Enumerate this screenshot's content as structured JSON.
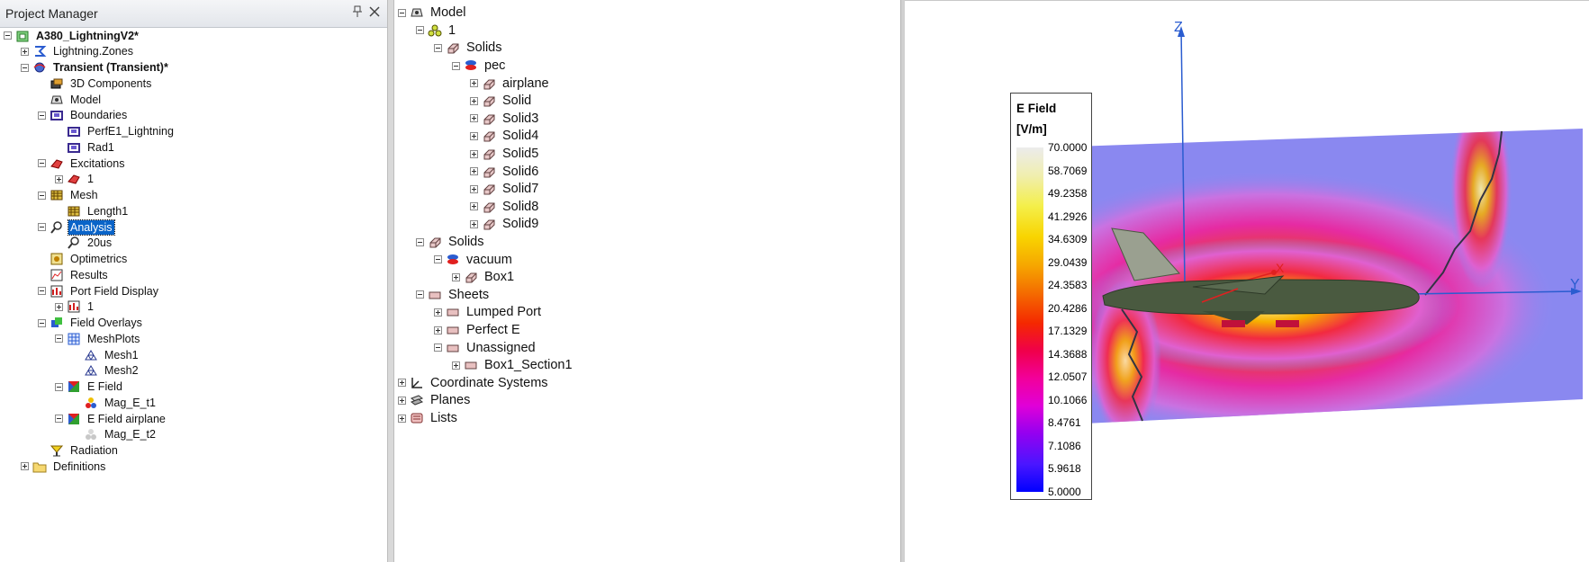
{
  "project_manager": {
    "title": "Project Manager",
    "pin_icon": "pin-icon",
    "close_icon": "close-icon",
    "items": [
      {
        "label": "A380_LightningV2*",
        "icon": "project-icon",
        "level": 0,
        "exp": "minus",
        "bold": true
      },
      {
        "label": "Lightning.Zones",
        "icon": "design-icon",
        "level": 1,
        "exp": "plus"
      },
      {
        "label": "Transient (Transient)*",
        "icon": "transient-icon",
        "level": 1,
        "exp": "minus",
        "bold": true
      },
      {
        "label": "3D Components",
        "icon": "components-icon",
        "level": 2,
        "exp": "none"
      },
      {
        "label": "Model",
        "icon": "model-icon",
        "level": 2,
        "exp": "none"
      },
      {
        "label": "Boundaries",
        "icon": "boundary-icon",
        "level": 2,
        "exp": "minus"
      },
      {
        "label": "PerfE1_Lightning",
        "icon": "boundary-icon",
        "level": 3,
        "exp": "none"
      },
      {
        "label": "Rad1",
        "icon": "boundary-icon",
        "level": 3,
        "exp": "none"
      },
      {
        "label": "Excitations",
        "icon": "excitation-icon",
        "level": 2,
        "exp": "minus"
      },
      {
        "label": "1",
        "icon": "excitation-icon",
        "level": 3,
        "exp": "plus"
      },
      {
        "label": "Mesh",
        "icon": "mesh-icon",
        "level": 2,
        "exp": "minus"
      },
      {
        "label": "Length1",
        "icon": "mesh-icon",
        "level": 3,
        "exp": "none"
      },
      {
        "label": "Analysis",
        "icon": "analysis-icon",
        "level": 2,
        "exp": "minus",
        "selected": true
      },
      {
        "label": "20us",
        "icon": "analysis-icon",
        "level": 3,
        "exp": "none"
      },
      {
        "label": "Optimetrics",
        "icon": "optimetrics-icon",
        "level": 2,
        "exp": "none"
      },
      {
        "label": "Results",
        "icon": "results-icon",
        "level": 2,
        "exp": "none"
      },
      {
        "label": "Port Field Display",
        "icon": "port-field-icon",
        "level": 2,
        "exp": "minus"
      },
      {
        "label": "1",
        "icon": "port-field-icon",
        "level": 3,
        "exp": "plus"
      },
      {
        "label": "Field Overlays",
        "icon": "field-overlays-icon",
        "level": 2,
        "exp": "minus"
      },
      {
        "label": "MeshPlots",
        "icon": "meshplots-icon",
        "level": 3,
        "exp": "minus"
      },
      {
        "label": "Mesh1",
        "icon": "triangle-mesh-icon",
        "level": 4,
        "exp": "none"
      },
      {
        "label": "Mesh2",
        "icon": "triangle-mesh-icon",
        "level": 4,
        "exp": "none"
      },
      {
        "label": "E Field",
        "icon": "efield-icon",
        "level": 3,
        "exp": "minus"
      },
      {
        "label": "Mag_E_t1",
        "icon": "field-plot-icon",
        "level": 4,
        "exp": "none"
      },
      {
        "label": "E Field airplane",
        "icon": "efield-icon",
        "level": 3,
        "exp": "minus"
      },
      {
        "label": "Mag_E_t2",
        "icon": "field-plot-gray-icon",
        "level": 4,
        "exp": "none"
      },
      {
        "label": "Radiation",
        "icon": "radiation-icon",
        "level": 2,
        "exp": "none"
      },
      {
        "label": "Definitions",
        "icon": "folder-icon",
        "level": 1,
        "exp": "plus"
      }
    ]
  },
  "model_tree": {
    "items": [
      {
        "label": "Model",
        "icon": "model-icon",
        "level": 0,
        "exp": "minus"
      },
      {
        "label": "1",
        "icon": "group-icon",
        "level": 1,
        "exp": "minus"
      },
      {
        "label": "Solids",
        "icon": "solid-icon",
        "level": 2,
        "exp": "minus"
      },
      {
        "label": "pec",
        "icon": "material-icon",
        "level": 3,
        "exp": "minus"
      },
      {
        "label": "airplane",
        "icon": "solid-icon",
        "level": 4,
        "exp": "plus"
      },
      {
        "label": "Solid",
        "icon": "solid-icon",
        "level": 4,
        "exp": "plus"
      },
      {
        "label": "Solid3",
        "icon": "solid-icon",
        "level": 4,
        "exp": "plus"
      },
      {
        "label": "Solid4",
        "icon": "solid-icon",
        "level": 4,
        "exp": "plus"
      },
      {
        "label": "Solid5",
        "icon": "solid-icon",
        "level": 4,
        "exp": "plus"
      },
      {
        "label": "Solid6",
        "icon": "solid-icon",
        "level": 4,
        "exp": "plus"
      },
      {
        "label": "Solid7",
        "icon": "solid-icon",
        "level": 4,
        "exp": "plus"
      },
      {
        "label": "Solid8",
        "icon": "solid-icon",
        "level": 4,
        "exp": "plus"
      },
      {
        "label": "Solid9",
        "icon": "solid-icon",
        "level": 4,
        "exp": "plus"
      },
      {
        "label": "Solids",
        "icon": "solid-icon",
        "level": 1,
        "exp": "minus"
      },
      {
        "label": "vacuum",
        "icon": "material-icon",
        "level": 2,
        "exp": "minus"
      },
      {
        "label": "Box1",
        "icon": "solid-icon",
        "level": 3,
        "exp": "plus"
      },
      {
        "label": "Sheets",
        "icon": "sheet-icon",
        "level": 1,
        "exp": "minus"
      },
      {
        "label": "Lumped Port",
        "icon": "sheet-icon",
        "level": 2,
        "exp": "plus"
      },
      {
        "label": "Perfect E",
        "icon": "sheet-icon",
        "level": 2,
        "exp": "plus"
      },
      {
        "label": "Unassigned",
        "icon": "sheet-icon",
        "level": 2,
        "exp": "minus"
      },
      {
        "label": "Box1_Section1",
        "icon": "sheet-icon",
        "level": 3,
        "exp": "plus"
      },
      {
        "label": "Coordinate Systems",
        "icon": "coordinate-icon",
        "level": 0,
        "exp": "plus"
      },
      {
        "label": "Planes",
        "icon": "planes-icon",
        "level": 0,
        "exp": "plus"
      },
      {
        "label": "Lists",
        "icon": "lists-icon",
        "level": 0,
        "exp": "plus"
      }
    ]
  },
  "view3d": {
    "legend": {
      "title": "E Field",
      "unit": "[V/m]",
      "ticks": [
        "70.0000",
        "58.7069",
        "49.2358",
        "41.2926",
        "34.6309",
        "29.0439",
        "24.3583",
        "20.4286",
        "17.1329",
        "14.3688",
        "12.0507",
        "10.1066",
        "8.4761",
        "7.1086",
        "5.9618",
        "5.0000"
      ]
    },
    "axes": {
      "z": "Z",
      "y": "Y",
      "x": "X"
    },
    "colors": {
      "low": "#0000ff",
      "plane_background": "#8a88f0",
      "high": "#f0f0f0",
      "airplane": "#4a5a40",
      "axis": "#2a5cd0"
    }
  }
}
